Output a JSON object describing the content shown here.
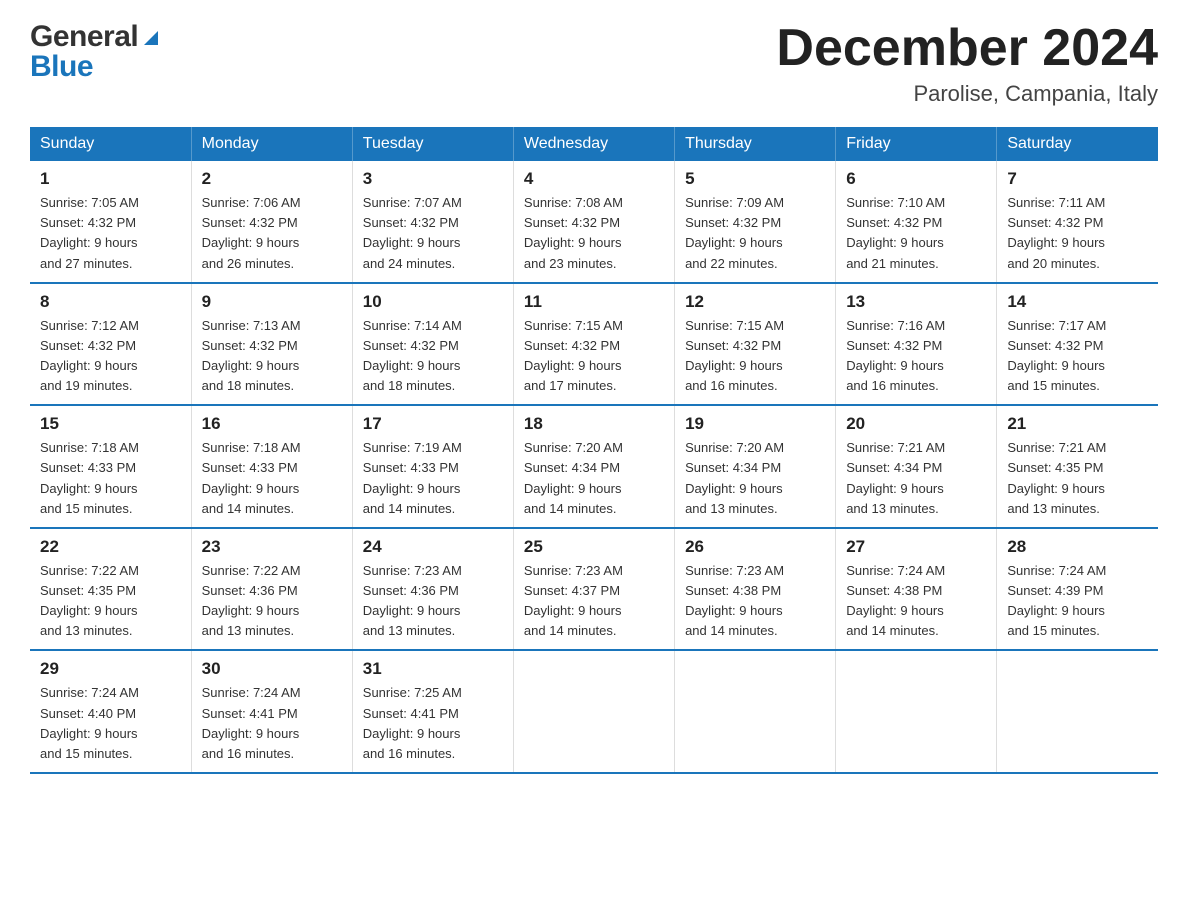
{
  "header": {
    "logo_general": "General",
    "logo_blue": "Blue",
    "month_title": "December 2024",
    "location": "Parolise, Campania, Italy"
  },
  "days_of_week": [
    "Sunday",
    "Monday",
    "Tuesday",
    "Wednesday",
    "Thursday",
    "Friday",
    "Saturday"
  ],
  "weeks": [
    [
      {
        "day": "1",
        "sunrise": "7:05 AM",
        "sunset": "4:32 PM",
        "daylight": "9 hours and 27 minutes."
      },
      {
        "day": "2",
        "sunrise": "7:06 AM",
        "sunset": "4:32 PM",
        "daylight": "9 hours and 26 minutes."
      },
      {
        "day": "3",
        "sunrise": "7:07 AM",
        "sunset": "4:32 PM",
        "daylight": "9 hours and 24 minutes."
      },
      {
        "day": "4",
        "sunrise": "7:08 AM",
        "sunset": "4:32 PM",
        "daylight": "9 hours and 23 minutes."
      },
      {
        "day": "5",
        "sunrise": "7:09 AM",
        "sunset": "4:32 PM",
        "daylight": "9 hours and 22 minutes."
      },
      {
        "day": "6",
        "sunrise": "7:10 AM",
        "sunset": "4:32 PM",
        "daylight": "9 hours and 21 minutes."
      },
      {
        "day": "7",
        "sunrise": "7:11 AM",
        "sunset": "4:32 PM",
        "daylight": "9 hours and 20 minutes."
      }
    ],
    [
      {
        "day": "8",
        "sunrise": "7:12 AM",
        "sunset": "4:32 PM",
        "daylight": "9 hours and 19 minutes."
      },
      {
        "day": "9",
        "sunrise": "7:13 AM",
        "sunset": "4:32 PM",
        "daylight": "9 hours and 18 minutes."
      },
      {
        "day": "10",
        "sunrise": "7:14 AM",
        "sunset": "4:32 PM",
        "daylight": "9 hours and 18 minutes."
      },
      {
        "day": "11",
        "sunrise": "7:15 AM",
        "sunset": "4:32 PM",
        "daylight": "9 hours and 17 minutes."
      },
      {
        "day": "12",
        "sunrise": "7:15 AM",
        "sunset": "4:32 PM",
        "daylight": "9 hours and 16 minutes."
      },
      {
        "day": "13",
        "sunrise": "7:16 AM",
        "sunset": "4:32 PM",
        "daylight": "9 hours and 16 minutes."
      },
      {
        "day": "14",
        "sunrise": "7:17 AM",
        "sunset": "4:32 PM",
        "daylight": "9 hours and 15 minutes."
      }
    ],
    [
      {
        "day": "15",
        "sunrise": "7:18 AM",
        "sunset": "4:33 PM",
        "daylight": "9 hours and 15 minutes."
      },
      {
        "day": "16",
        "sunrise": "7:18 AM",
        "sunset": "4:33 PM",
        "daylight": "9 hours and 14 minutes."
      },
      {
        "day": "17",
        "sunrise": "7:19 AM",
        "sunset": "4:33 PM",
        "daylight": "9 hours and 14 minutes."
      },
      {
        "day": "18",
        "sunrise": "7:20 AM",
        "sunset": "4:34 PM",
        "daylight": "9 hours and 14 minutes."
      },
      {
        "day": "19",
        "sunrise": "7:20 AM",
        "sunset": "4:34 PM",
        "daylight": "9 hours and 13 minutes."
      },
      {
        "day": "20",
        "sunrise": "7:21 AM",
        "sunset": "4:34 PM",
        "daylight": "9 hours and 13 minutes."
      },
      {
        "day": "21",
        "sunrise": "7:21 AM",
        "sunset": "4:35 PM",
        "daylight": "9 hours and 13 minutes."
      }
    ],
    [
      {
        "day": "22",
        "sunrise": "7:22 AM",
        "sunset": "4:35 PM",
        "daylight": "9 hours and 13 minutes."
      },
      {
        "day": "23",
        "sunrise": "7:22 AM",
        "sunset": "4:36 PM",
        "daylight": "9 hours and 13 minutes."
      },
      {
        "day": "24",
        "sunrise": "7:23 AM",
        "sunset": "4:36 PM",
        "daylight": "9 hours and 13 minutes."
      },
      {
        "day": "25",
        "sunrise": "7:23 AM",
        "sunset": "4:37 PM",
        "daylight": "9 hours and 14 minutes."
      },
      {
        "day": "26",
        "sunrise": "7:23 AM",
        "sunset": "4:38 PM",
        "daylight": "9 hours and 14 minutes."
      },
      {
        "day": "27",
        "sunrise": "7:24 AM",
        "sunset": "4:38 PM",
        "daylight": "9 hours and 14 minutes."
      },
      {
        "day": "28",
        "sunrise": "7:24 AM",
        "sunset": "4:39 PM",
        "daylight": "9 hours and 15 minutes."
      }
    ],
    [
      {
        "day": "29",
        "sunrise": "7:24 AM",
        "sunset": "4:40 PM",
        "daylight": "9 hours and 15 minutes."
      },
      {
        "day": "30",
        "sunrise": "7:24 AM",
        "sunset": "4:41 PM",
        "daylight": "9 hours and 16 minutes."
      },
      {
        "day": "31",
        "sunrise": "7:25 AM",
        "sunset": "4:41 PM",
        "daylight": "9 hours and 16 minutes."
      },
      null,
      null,
      null,
      null
    ]
  ],
  "labels": {
    "sunrise": "Sunrise:",
    "sunset": "Sunset:",
    "daylight": "Daylight:"
  }
}
